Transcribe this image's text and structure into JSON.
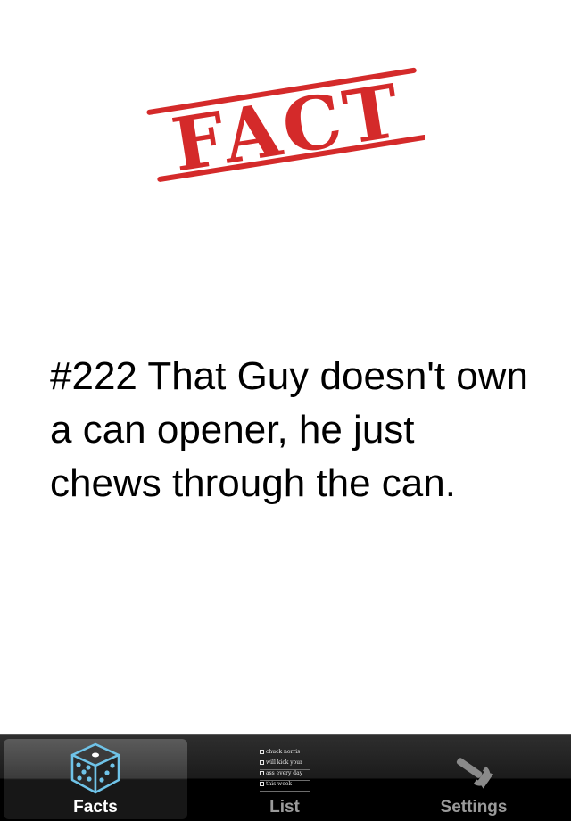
{
  "stamp": {
    "text": "FACT",
    "color": "#d42a2a"
  },
  "fact": {
    "text": "#222 That Guy doesn't own a can opener, he just chews through the can."
  },
  "tabbar": {
    "tabs": [
      {
        "label": "Facts",
        "icon": "dice-icon",
        "selected": true
      },
      {
        "label": "List",
        "icon": "checklist-icon",
        "selected": false
      },
      {
        "label": "Settings",
        "icon": "wrench-icon",
        "selected": false
      }
    ],
    "list_icon_rows": [
      "chuck norris",
      "will kick your",
      "ass every day",
      "this week"
    ]
  }
}
